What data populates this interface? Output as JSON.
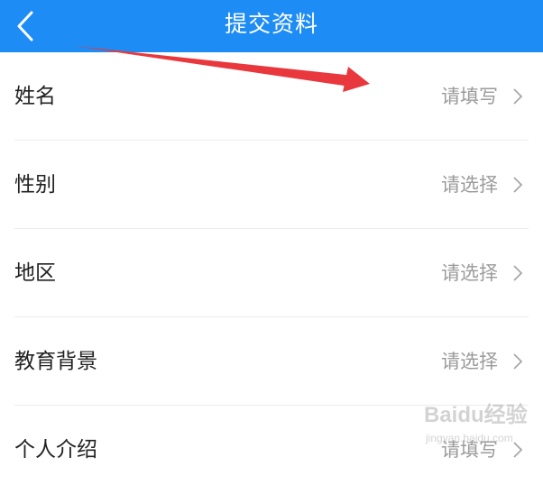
{
  "header": {
    "title": "提交资料",
    "back_icon": "chevron-left-icon",
    "background": "#1e8cf5"
  },
  "form": {
    "rows": [
      {
        "label": "姓名",
        "value": "请填写"
      },
      {
        "label": "性别",
        "value": "请选择"
      },
      {
        "label": "地区",
        "value": "请选择"
      },
      {
        "label": "教育背景",
        "value": "请选择"
      },
      {
        "label": "个人介绍",
        "value": "请填写"
      }
    ],
    "chevron_icon": "chevron-right-icon",
    "value_color": "#9b9b9b"
  },
  "annotation": {
    "icon": "red-arrow-icon",
    "color": "#e8383d"
  },
  "watermark": {
    "text": "Baidu经验",
    "url": "jingyan.baidu.com"
  }
}
